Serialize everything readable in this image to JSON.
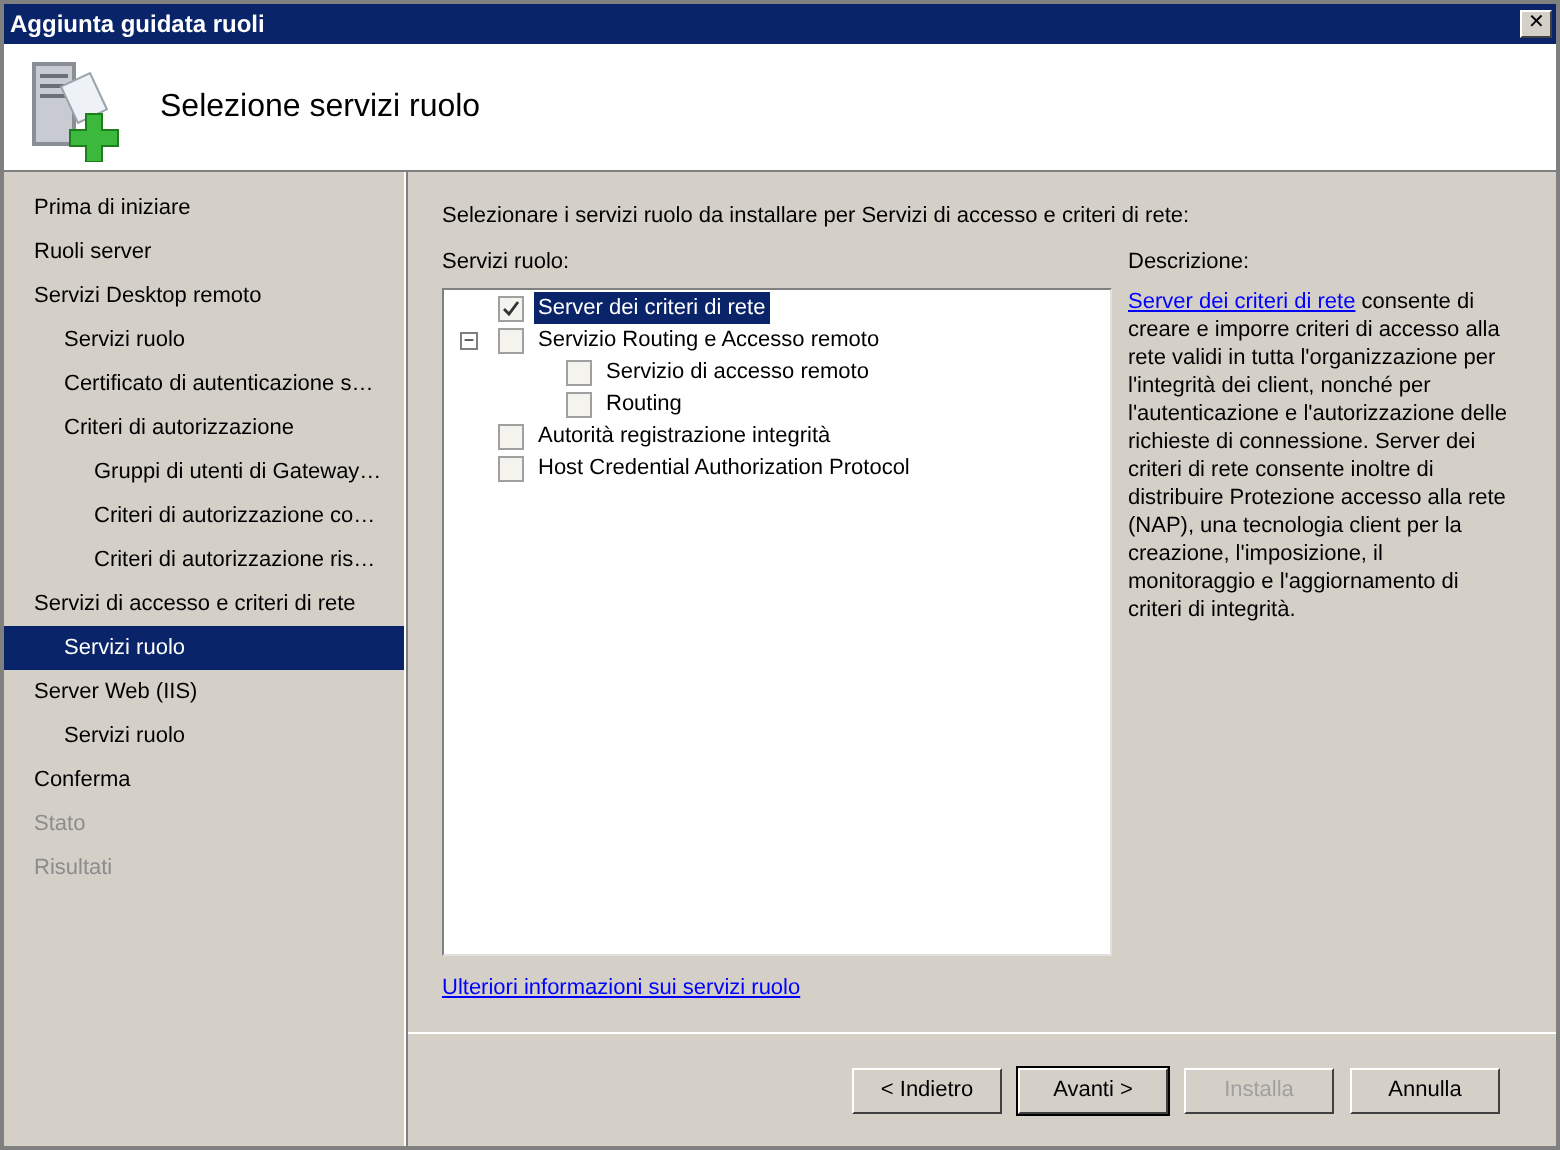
{
  "window": {
    "title": "Aggiunta guidata ruoli",
    "close": "✕"
  },
  "header": {
    "title": "Selezione servizi ruolo"
  },
  "sidebar": {
    "items": [
      {
        "label": "Prima di iniziare",
        "selected": false,
        "disabled": false
      },
      {
        "label": "Ruoli server",
        "selected": false,
        "disabled": false
      },
      {
        "label": "Servizi Desktop remoto",
        "selected": false,
        "disabled": false,
        "children": [
          {
            "label": "Servizi ruolo",
            "selected": false,
            "disabled": false
          },
          {
            "label": "Certificato di autenticazione s…",
            "selected": false,
            "disabled": false
          },
          {
            "label": "Criteri di autorizzazione",
            "selected": false,
            "disabled": false,
            "children": [
              {
                "label": "Gruppi di utenti di Gateway…",
                "selected": false,
                "disabled": false
              },
              {
                "label": "Criteri di autorizzazione co…",
                "selected": false,
                "disabled": false
              },
              {
                "label": "Criteri di autorizzazione ris…",
                "selected": false,
                "disabled": false
              }
            ]
          }
        ]
      },
      {
        "label": "Servizi di accesso e criteri di rete",
        "selected": false,
        "disabled": false,
        "children": [
          {
            "label": "Servizi ruolo",
            "selected": true,
            "disabled": false
          }
        ]
      },
      {
        "label": "Server Web (IIS)",
        "selected": false,
        "disabled": false,
        "children": [
          {
            "label": "Servizi ruolo",
            "selected": false,
            "disabled": false
          }
        ]
      },
      {
        "label": "Conferma",
        "selected": false,
        "disabled": false
      },
      {
        "label": "Stato",
        "selected": false,
        "disabled": true
      },
      {
        "label": "Risultati",
        "selected": false,
        "disabled": true
      }
    ]
  },
  "instruction": "Selezionare i servizi ruolo da installare per Servizi di accesso e criteri di rete:",
  "role_services": {
    "label": "Servizi ruolo:",
    "items": [
      {
        "label": "Server dei criteri di rete",
        "checked": true,
        "selected": true
      },
      {
        "label": "Servizio Routing e Accesso remoto",
        "checked": false,
        "selected": false,
        "expanded": true,
        "toggle": "−",
        "children": [
          {
            "label": "Servizio di accesso remoto",
            "checked": false,
            "selected": false
          },
          {
            "label": "Routing",
            "checked": false,
            "selected": false
          }
        ]
      },
      {
        "label": "Autorità registrazione integrità",
        "checked": false,
        "selected": false
      },
      {
        "label": "Host Credential Authorization Protocol",
        "checked": false,
        "selected": false
      }
    ]
  },
  "description": {
    "label": "Descrizione:",
    "link": "Server dei criteri di rete",
    "text": " consente di creare e imporre criteri di accesso alla rete validi in tutta l'organizzazione per l'integrità dei client, nonché per l'autenticazione e l'autorizzazione delle richieste di connessione. Server dei criteri di rete consente inoltre di distribuire Protezione accesso alla rete (NAP), una tecnologia client per la creazione, l'imposizione, il monitoraggio e l'aggiornamento di criteri di integrità."
  },
  "more_info_link": "Ulteriori informazioni sui servizi ruolo",
  "buttons": [
    {
      "label": "< Indietro",
      "disabled": false,
      "default": false
    },
    {
      "label": "Avanti >",
      "disabled": false,
      "default": true
    },
    {
      "label": "Installa",
      "disabled": true,
      "default": false
    },
    {
      "label": "Annulla",
      "disabled": false,
      "default": false
    }
  ]
}
